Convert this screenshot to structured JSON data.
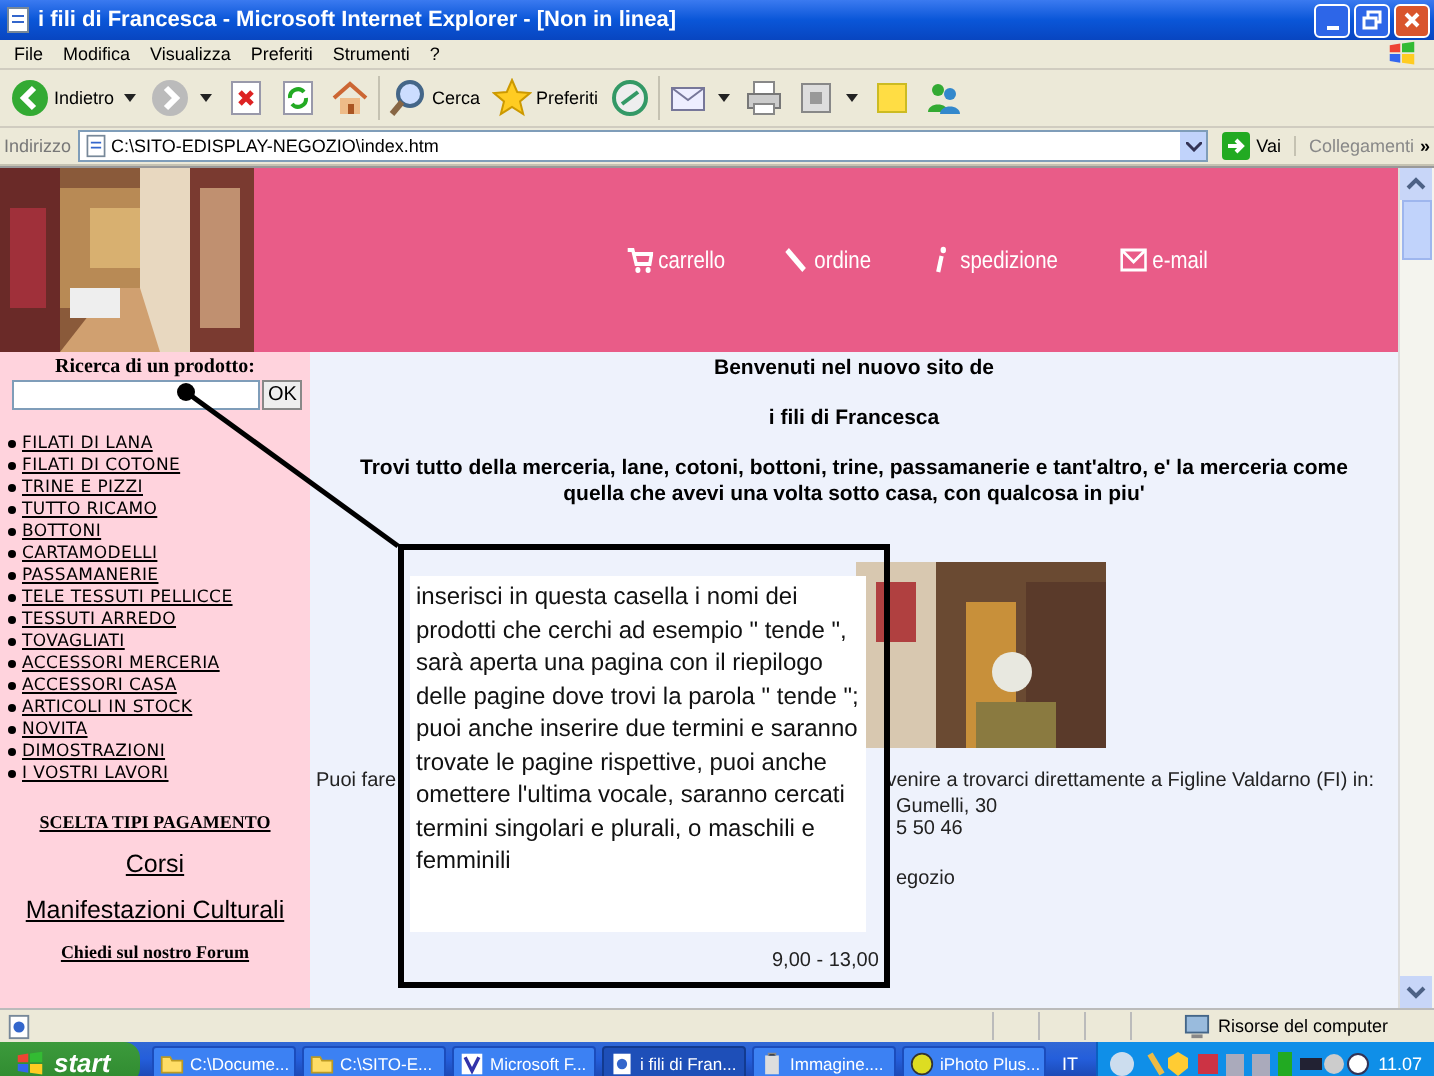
{
  "window": {
    "title": "i fili di Francesca - Microsoft Internet Explorer - [Non in linea]"
  },
  "menu": [
    "File",
    "Modifica",
    "Visualizza",
    "Preferiti",
    "Strumenti",
    "?"
  ],
  "toolbar": [
    {
      "kind": "back",
      "label": "Indietro",
      "dropdown": true
    },
    {
      "kind": "forward",
      "dropdown": true
    },
    {
      "kind": "stop"
    },
    {
      "kind": "refresh"
    },
    {
      "kind": "home"
    },
    {
      "kind": "search",
      "label": "Cerca"
    },
    {
      "kind": "favorites",
      "label": "Preferiti"
    },
    {
      "kind": "media"
    },
    {
      "kind": "mail",
      "dropdown": true
    },
    {
      "kind": "print"
    },
    {
      "kind": "edit",
      "dropdown": true
    },
    {
      "kind": "notes"
    },
    {
      "kind": "messenger"
    }
  ],
  "address": {
    "label": "Indirizzo",
    "value": "C:\\SITO-EDISPLAY-NEGOZIO\\index.htm",
    "go": "Vai",
    "links": "Collegamenti",
    "more": "»"
  },
  "site": {
    "nav": [
      {
        "kind": "cart",
        "label": "carrello"
      },
      {
        "kind": "pen",
        "label": "ordine"
      },
      {
        "kind": "info",
        "label": "spedizione"
      },
      {
        "kind": "mail",
        "label": "e-mail"
      }
    ],
    "search": {
      "title": "Ricerca di un prodotto:",
      "button": "OK"
    },
    "categories": [
      "FILATI DI LANA",
      "FILATI DI COTONE",
      "TRINE E PIZZI",
      "TUTTO RICAMO",
      "BOTTONI",
      "CARTAMODELLI",
      "PASSAMANERIE",
      "TELE TESSUTI PELLICCE",
      "TESSUTI ARREDO",
      "TOVAGLIATI",
      "ACCESSORI MERCERIA",
      "ACCESSORI CASA",
      "ARTICOLI IN STOCK",
      "NOVITA",
      "DIMOSTRAZIONI",
      "I VOSTRI LAVORI"
    ],
    "links": [
      {
        "kind": "small",
        "label": "SCELTA TIPI PAGAMENTO"
      },
      {
        "kind": "large",
        "label": "Corsi"
      },
      {
        "kind": "large",
        "label": "Manifestazioni Culturali"
      },
      {
        "kind": "small",
        "label": "Chiedi sul nostro Forum"
      }
    ],
    "welcome": "Benvenuti nel nuovo sito de",
    "name": "i fili di Francesca",
    "intro": "Trovi tutto della merceria, lane, cotoni, bottoni, trine, passamanerie e tant'altro, e' la merceria come quella che avevi una volta sotto casa, con qualcosa in piu'",
    "visit_start": "Puoi fare",
    "visit_end": "venire a trovarci direttamente a Figline Valdarno (FI) in:",
    "info_lines": [
      "Gumelli, 30",
      "5 50 46",
      "egozio",
      "9,00 - 13,00"
    ]
  },
  "callout": "inserisci in questa casella i nomi dei prodotti che cerchi ad esempio \" tende \", sarà aperta una pagina con il riepilogo delle pagine dove trovi la parola \" tende \"; puoi anche inserire due termini e saranno trovate le pagine rispettive, puoi anche omettere l'ultima vocale, saranno cercati termini singolari e plurali, o maschili e femminili",
  "status_bar": {
    "zone": "Risorse del computer"
  },
  "taskbar": {
    "start": "start",
    "tasks": [
      {
        "kind": "folder",
        "label": "C:\\Docume...",
        "selected": false
      },
      {
        "kind": "folder",
        "label": "C:\\SITO-E...",
        "selected": false
      },
      {
        "kind": "app",
        "label": "Microsoft F...",
        "selected": false
      },
      {
        "kind": "browser",
        "label": "i fili di Fran...",
        "selected": true
      },
      {
        "kind": "paint",
        "label": "Immagine....",
        "selected": false
      },
      {
        "label": "iPhoto Plus...",
        "selected": false
      }
    ],
    "language": "IT",
    "clock": "11.07"
  }
}
